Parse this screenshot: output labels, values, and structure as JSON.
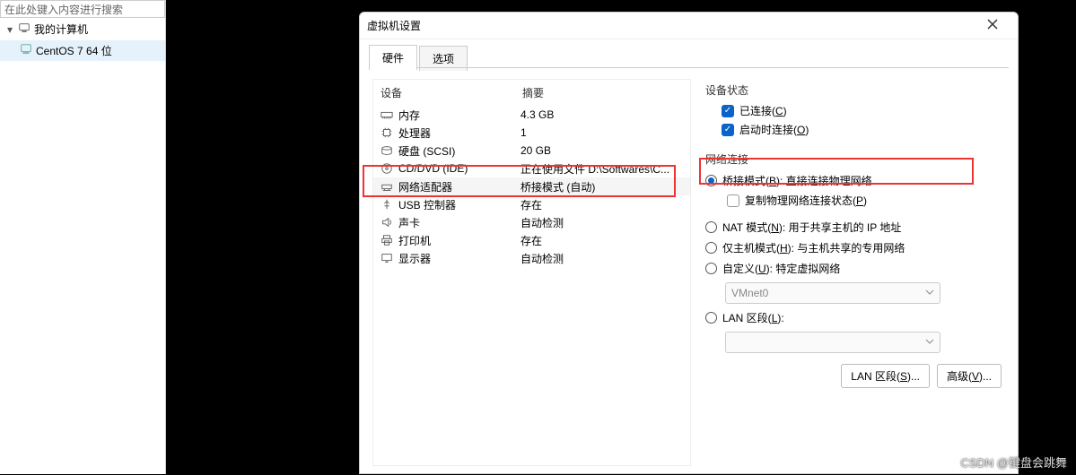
{
  "sidebar": {
    "search_placeholder": "在此处键入内容进行搜索",
    "my_computer": "我的计算机",
    "vm1": "CentOS 7 64 位"
  },
  "dialog": {
    "title": "虚拟机设置",
    "tabs": {
      "hardware": "硬件",
      "options": "选项"
    },
    "device_header": {
      "device": "设备",
      "summary": "摘要"
    },
    "devices": [
      {
        "name": "内存",
        "summary": "4.3 GB"
      },
      {
        "name": "处理器",
        "summary": "1"
      },
      {
        "name": "硬盘 (SCSI)",
        "summary": "20 GB"
      },
      {
        "name": "CD/DVD (IDE)",
        "summary": "正在使用文件 D:\\Softwares\\C..."
      },
      {
        "name": "网络适配器",
        "summary": "桥接模式 (自动)"
      },
      {
        "name": "USB 控制器",
        "summary": "存在"
      },
      {
        "name": "声卡",
        "summary": "自动检测"
      },
      {
        "name": "打印机",
        "summary": "存在"
      },
      {
        "name": "显示器",
        "summary": "自动检测"
      }
    ],
    "status": {
      "group": "设备状态",
      "connected_pre": "已连接(",
      "connected_u": "C",
      "connected_post": ")",
      "connect_on_pre": "启动时连接(",
      "connect_on_u": "O",
      "connect_on_post": ")"
    },
    "network": {
      "group": "网络连接",
      "bridged_pre": "桥接模式(",
      "bridged_u": "B",
      "bridged_post": "): 直接连接物理网络",
      "replicate_pre": "复制物理网络连接状态(",
      "replicate_u": "P",
      "replicate_post": ")",
      "nat_pre": "NAT 模式(",
      "nat_u": "N",
      "nat_post": "): 用于共享主机的 IP 地址",
      "host_pre": "仅主机模式(",
      "host_u": "H",
      "host_post": "): 与主机共享的专用网络",
      "custom_pre": "自定义(",
      "custom_u": "U",
      "custom_post": "): 特定虚拟网络",
      "vmnet_value": "VMnet0",
      "lan_pre": "LAN 区段(",
      "lan_u": "L",
      "lan_post": "):",
      "lan_seg_empty": "",
      "lan_btn_pre": "LAN 区段(",
      "lan_btn_u": "S",
      "lan_btn_post": ")...",
      "adv_btn_pre": "高级(",
      "adv_btn_u": "V",
      "adv_btn_post": ")..."
    }
  },
  "watermark": "CSDN @键盘会跳舞"
}
